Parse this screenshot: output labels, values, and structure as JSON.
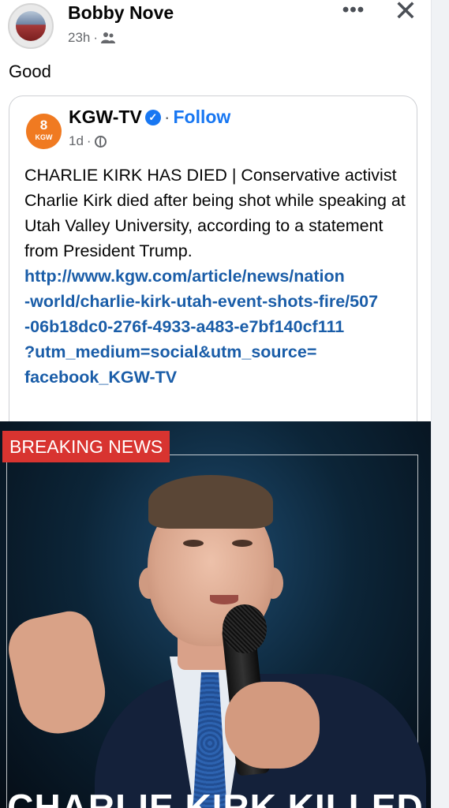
{
  "post": {
    "author": "Bobby Nove",
    "time": "23h",
    "meta_sep": "·",
    "audience_icon": "friends-icon",
    "text": "Good"
  },
  "shared": {
    "page_name": "KGW-TV",
    "page_logo_number": "8",
    "page_logo_label": "KGW",
    "verified_icon": "verified-icon",
    "dot": "·",
    "follow_label": "Follow",
    "time": "1d",
    "meta_sep": "·",
    "audience_icon": "globe-icon",
    "body_text": "CHARLIE KIRK HAS DIED | Conservative activist Charlie Kirk died after being shot while speaking at Utah Valley University, according to a statement from President Trump.",
    "link_lines": [
      "http://www.kgw.com/article/news/nation",
      "-world/charlie-kirk-utah-event-shots-fire/507",
      "-06b18dc0-276f-4933-a483-e7bf140cf111",
      "?utm_medium=social&utm_source=",
      "facebook_KGW-TV"
    ]
  },
  "image": {
    "badge": "BREAKING NEWS",
    "headline": "CHARLIE KIRK KILLED"
  },
  "colors": {
    "link": "#1a5da8",
    "follow": "#1877f2",
    "badge": "#d83430",
    "logo": "#f07a21"
  }
}
